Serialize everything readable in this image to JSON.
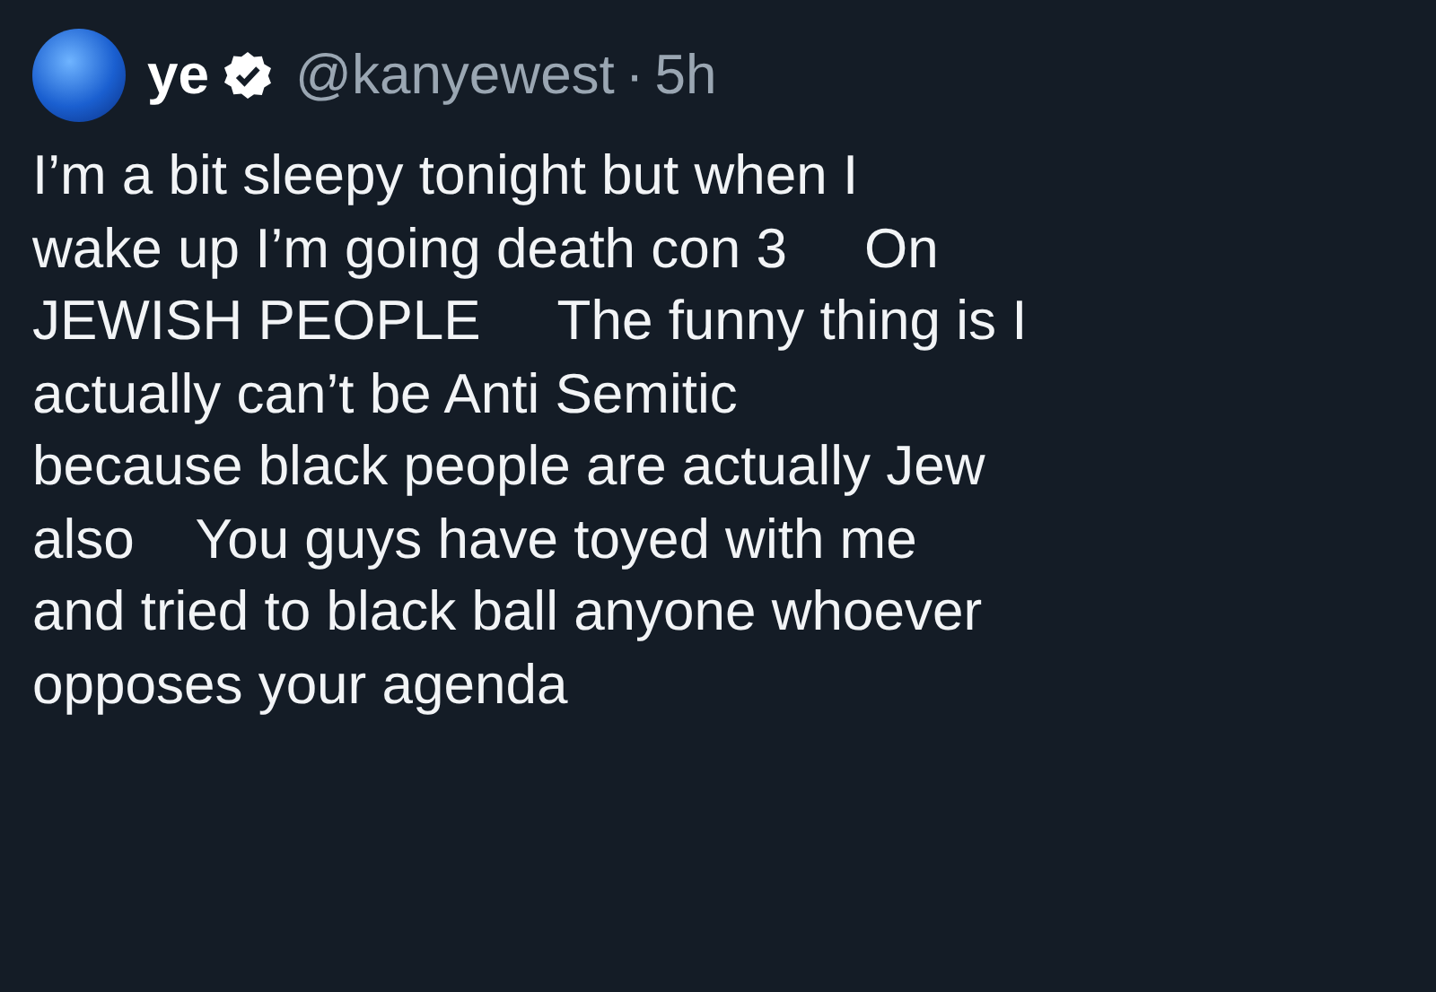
{
  "author": {
    "name": "ye",
    "verified": true,
    "handle": "@kanyewest",
    "separator": "·",
    "time": "5h"
  },
  "body": "I’m a bit sleepy tonight but when I\nwake up I’m going death con 3     On\nJEWISH PEOPLE     The funny thing is I\nactually can’t be Anti Semitic\nbecause black people are actually Jew\nalso    You guys have toyed with me\nand tried to black ball anyone whoever\nopposes your agenda"
}
